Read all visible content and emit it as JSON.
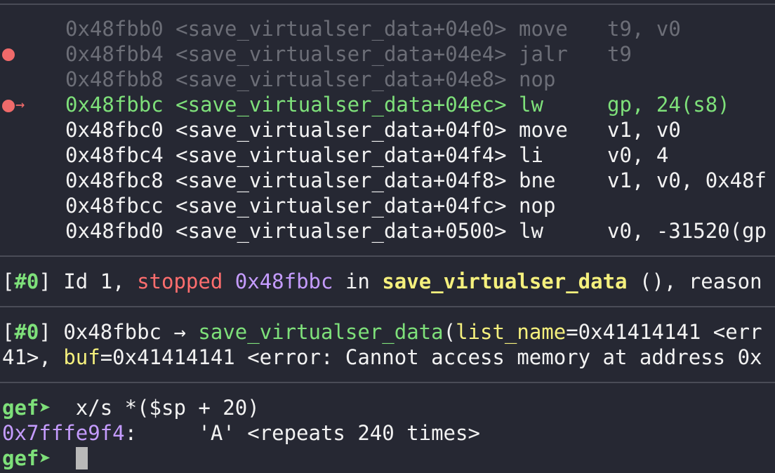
{
  "disasm": [
    {
      "addr": "0x48fbb0",
      "sym": "<save_virtualser_data+04e0>",
      "op": "move",
      "args": "t9, v0",
      "state": "past"
    },
    {
      "addr": "0x48fbb4",
      "sym": "<save_virtualser_data+04e4>",
      "op": "jalr",
      "args": "t9",
      "state": "past"
    },
    {
      "addr": "0x48fbb8",
      "sym": "<save_virtualser_data+04e8>",
      "op": "nop",
      "args": "",
      "state": "past"
    },
    {
      "addr": "0x48fbbc",
      "sym": "<save_virtualser_data+04ec>",
      "op": "lw",
      "args": "gp, 24(s8)",
      "state": "current"
    },
    {
      "addr": "0x48fbc0",
      "sym": "<save_virtualser_data+04f0>",
      "op": "move",
      "args": "v1, v0",
      "state": "future"
    },
    {
      "addr": "0x48fbc4",
      "sym": "<save_virtualser_data+04f4>",
      "op": "li",
      "args": "v0, 4",
      "state": "future"
    },
    {
      "addr": "0x48fbc8",
      "sym": "<save_virtualser_data+04f8>",
      "op": "bne",
      "args": "v1, v0, 0x48f",
      "state": "future"
    },
    {
      "addr": "0x48fbcc",
      "sym": "<save_virtualser_data+04fc>",
      "op": "nop",
      "args": "",
      "state": "future"
    },
    {
      "addr": "0x48fbd0",
      "sym": "<save_virtualser_data+0500>",
      "op": "lw",
      "args": "v0, -31520(gp",
      "state": "future"
    }
  ],
  "threads": {
    "idx": "#0",
    "id_text": "Id 1,",
    "status": "stopped",
    "addr": "0x48fbbc",
    "in": "in",
    "func": "save_virtualser_data",
    "rest": "(), reason"
  },
  "trace": {
    "idx": "#0",
    "addr": "0x48fbbc",
    "arrow": "→",
    "func": "save_virtualser_data",
    "paren": "(",
    "p1": "list_name",
    "v1": "=0x41414141 <err",
    "line2_start": "41>, ",
    "p2": "buf",
    "v2": "=0x41414141 <error: Cannot access memory at address 0x"
  },
  "prompt": {
    "label": "gef➤",
    "command": " x/s *($sp + 20)",
    "out_addr": "0x7fffe9f4",
    "out_rest": ":     'A' <repeats 240 times>"
  },
  "colors": {
    "background": "#262833",
    "current": "#7ee07a",
    "breakpoint": "#f06a6a",
    "stopped": "#ff6e6e",
    "address": "#c59cff",
    "function": "#f5f07d"
  }
}
